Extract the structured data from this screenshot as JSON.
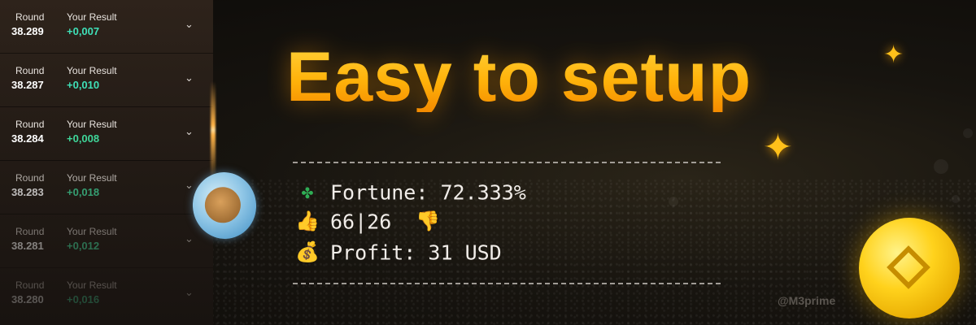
{
  "rounds": [
    {
      "round_label": "Round",
      "round_value": "38.289",
      "result_label": "Your Result",
      "result_value": "+0,007"
    },
    {
      "round_label": "Round",
      "round_value": "38.287",
      "result_label": "Your Result",
      "result_value": "+0,010"
    },
    {
      "round_label": "Round",
      "round_value": "38.284",
      "result_label": "Your Result",
      "result_value": "+0,008"
    },
    {
      "round_label": "Round",
      "round_value": "38.283",
      "result_label": "Your Result",
      "result_value": "+0,018"
    },
    {
      "round_label": "Round",
      "round_value": "38.281",
      "result_label": "Your Result",
      "result_value": "+0,012"
    },
    {
      "round_label": "Round",
      "round_value": "38.280",
      "result_label": "Your Result",
      "result_value": "+0,016"
    }
  ],
  "headline": "Easy to setup",
  "stats": {
    "fortune": "Fortune: 72.333%",
    "votes": "66|26",
    "profit": "Profit: 31 USD"
  },
  "icons": {
    "fortune": "four-leaf-clover-icon",
    "up": "thumbs-up-icon",
    "down": "thumbs-down-icon",
    "profit": "money-bag-icon",
    "expand": "chevron-down-icon"
  },
  "handle": "@M3prime",
  "colors": {
    "headline": "#ffb20a",
    "result_positive": "#3fe0b8",
    "accent": "#ffc01a"
  }
}
